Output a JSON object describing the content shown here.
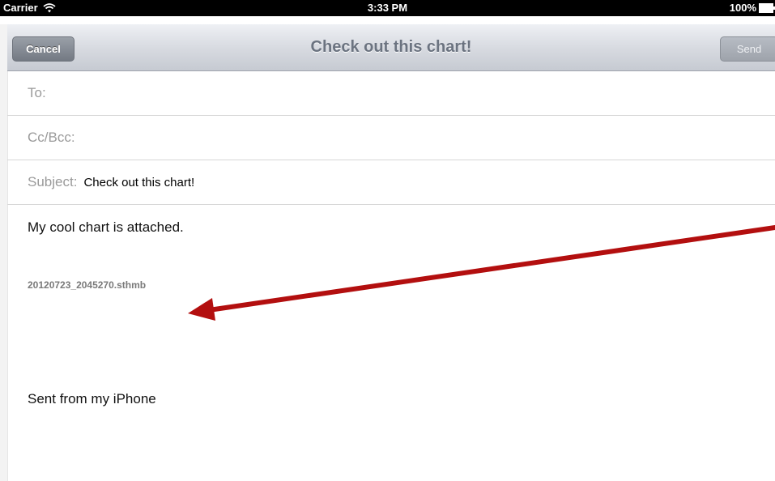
{
  "status_bar": {
    "carrier": "Carrier",
    "time": "3:33 PM",
    "battery": "100%"
  },
  "nav": {
    "title": "Check out this chart!",
    "cancel_label": "Cancel",
    "send_label": "Send"
  },
  "fields": {
    "to_label": "To:",
    "cc_label": "Cc/Bcc:",
    "subject_label": "Subject:",
    "subject_value": "Check out this chart!"
  },
  "body": {
    "message": "My cool chart is attached.",
    "attachment_name": "20120723_2045270.sthmb",
    "signature": "Sent from my iPhone"
  },
  "colors": {
    "annotation_arrow": "#b30f0f"
  }
}
